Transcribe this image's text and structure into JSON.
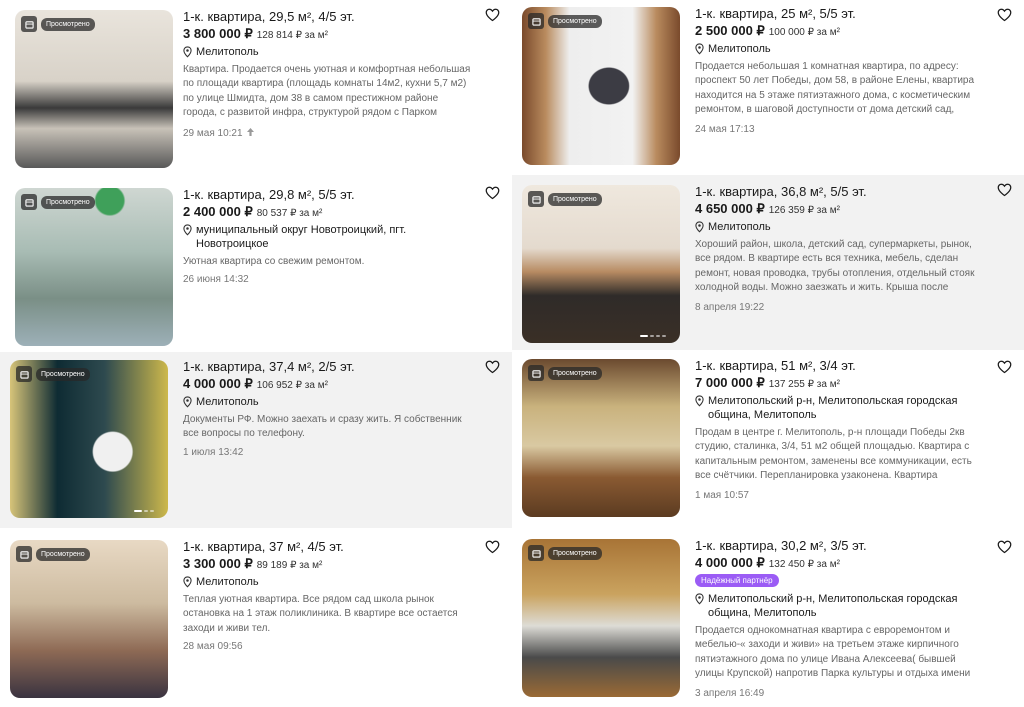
{
  "seen_label": "Просмотрено",
  "listings": [
    {
      "title": "1-к. квартира, 29,5 м², 4/5 эт.",
      "price": "3 800 000 ₽",
      "price_per_m2": "128 814 ₽ за м²",
      "location": "Мелитополь",
      "description": "Квартира. Продается очень уютная и комфортная небольшая по площади квартира (площадь комнаты 14м2, кухни 5,7 м2) по улице Шмидта, дом 38 в самом престижном районе города, с развитой инфра, структурой рядом с Парком культуры и отдых…",
      "date": "29 мая 10:21"
    },
    {
      "title": "1-к. квартира, 25 м², 5/5 эт.",
      "price": "2 500 000 ₽",
      "price_per_m2": "100 000 ₽ за м²",
      "location": "Мелитополь",
      "description": "Продается небольшая 1 комнатная квартира, по адресу: проспект 50 лет Победы, дом 58, в районе Елены, квартира находится на 5 этаже пятиэтажного дома, с косметическим ремонтом, в шаговой доступности от дома детский сад, школа,…",
      "date": "24 мая 17:13"
    },
    {
      "title": "1-к. квартира, 29,8 м², 5/5 эт.",
      "price": "2 400 000 ₽",
      "price_per_m2": "80 537 ₽ за м²",
      "location": "муниципальный округ Новотроицкий, пгт. Новотроицкое",
      "description": "Уютная квартира со свежим ремонтом.",
      "date": "26 июня 14:32"
    },
    {
      "title": "1-к. квартира, 36,8 м², 5/5 эт.",
      "price": "4 650 000 ₽",
      "price_per_m2": "126 359 ₽ за м²",
      "location": "Мелитополь",
      "description": "Хороший район, школа, детский сад, супермаркеты, рынок, все рядом. В квартире есть вся техника, мебель, сделан ремонт, новая проводка, трубы отопления, отдельный стояк холодной воды. Можно заезжать и жить. Крыша после ремонта. Тихие…",
      "date": "8 апреля 19:22"
    },
    {
      "title": "1-к. квартира, 37,4 м², 2/5 эт.",
      "price": "4 000 000 ₽",
      "price_per_m2": "106 952 ₽ за м²",
      "location": "Мелитополь",
      "description": "Документы РФ. Можно заехать и сразу жить. Я собственник все вопросы по телефону.",
      "date": "1 июля 13:42"
    },
    {
      "title": "1-к. квартира, 51 м², 3/4 эт.",
      "price": "7 000 000 ₽",
      "price_per_m2": "137 255 ₽ за м²",
      "location": "Мелитопольский р-н, Мелитопольская городская община, Мелитополь",
      "description": "Продам в центре г. Мелитополь, р-н площади Победы 2кв студию, сталинка, 3/4, 51 м2 общей площадью. Квартира с капитальным ремонтом, заменены все коммуникации, есть все счётчики. Перепланировка узаконена. Квартира продаётся с…",
      "date": "1 мая 10:57"
    },
    {
      "title": "1-к. квартира, 37 м², 4/5 эт.",
      "price": "3 300 000 ₽",
      "price_per_m2": "89 189 ₽ за м²",
      "location": "Мелитополь",
      "description": "Теплая уютная квартира. Все рядом сад школа рынок остановка на 1 этаж поликлиника. В квартире все остается заходи и живи тел.",
      "date": "28 мая 09:56"
    },
    {
      "title": "1-к. квартира, 30,2 м², 3/5 эт.",
      "price": "4 000 000 ₽",
      "price_per_m2": "132 450 ₽ за м²",
      "partner": "Надёжный партнёр",
      "location": "Мелитопольский р-н, Мелитопольская городская община, Мелитополь",
      "description": "Продается однокомнатная квартира с евроремонтом и мебелью-« заходи и живи» на третьем этаже кирпичного пятиэтажного дома по улице Ивана Алексеева( бывшей улицы Крупской) напротив Парка культуры и отдыха имени Максим…",
      "date": "3 апреля 16:49"
    }
  ]
}
